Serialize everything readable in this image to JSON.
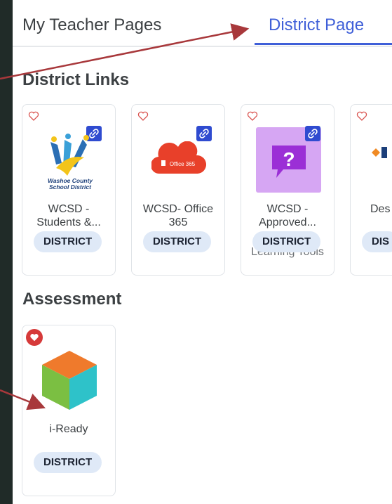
{
  "tabs": [
    {
      "label": "My Teacher Pages"
    },
    {
      "label": "District Page"
    }
  ],
  "sections": {
    "district_links": "District Links",
    "assessment": "Assessment"
  },
  "district_cards": [
    {
      "name_line1": "WCSD -",
      "name_line2": "Students &...",
      "badge": "DISTRICT",
      "favorited": false,
      "logo_text_1": "Washoe County",
      "logo_text_2": "School District"
    },
    {
      "name_line1": "WCSD- Office",
      "name_line2": "365",
      "badge": "DISTRICT",
      "favorited": false,
      "logo_text": "Office 365"
    },
    {
      "name_line1": "WCSD -",
      "name_line2": "Approved...",
      "name_overflow": "Learning Tools",
      "badge": "DISTRICT",
      "favorited": false,
      "logo_glyph": "?"
    },
    {
      "name_line1": "Des",
      "badge": "DIS",
      "favorited": false
    }
  ],
  "assessment_cards": [
    {
      "name": "i-Ready",
      "badge": "DISTRICT",
      "favorited": true
    }
  ],
  "colors": {
    "accent": "#3f5fd8",
    "annotation_arrow": "#a8383b",
    "pill_bg": "#dfe9f7",
    "link_badge": "#2f4bd0"
  },
  "icons": [
    "heart-icon",
    "link-icon",
    "washoe-logo",
    "office365-logo",
    "question-bubble-logo",
    "iready-cube-logo"
  ]
}
